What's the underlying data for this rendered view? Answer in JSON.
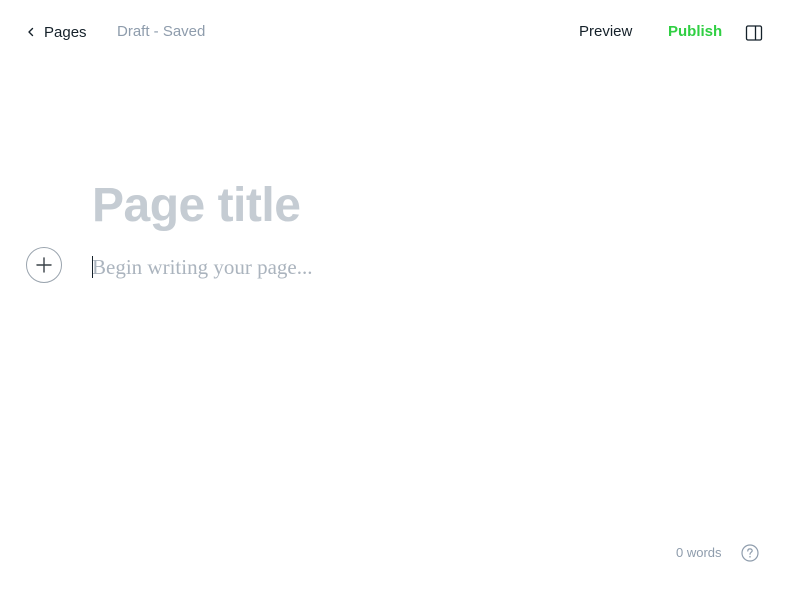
{
  "header": {
    "back_label": "Pages",
    "status": "Draft - Saved",
    "preview_label": "Preview",
    "publish_label": "Publish",
    "back_icon": "chevron-left-icon",
    "settings_icon": "sidebar-panel-icon"
  },
  "editor": {
    "title_placeholder": "Page title",
    "body_placeholder": "Begin writing your page...",
    "add_icon": "plus-icon"
  },
  "footer": {
    "word_count": "0 words",
    "help_icon": "question-circle-icon"
  },
  "colors": {
    "accent": "#30cf43",
    "muted_text": "#8e9cac",
    "placeholder_title": "#c5ccd3",
    "placeholder_body": "#abb4be"
  }
}
